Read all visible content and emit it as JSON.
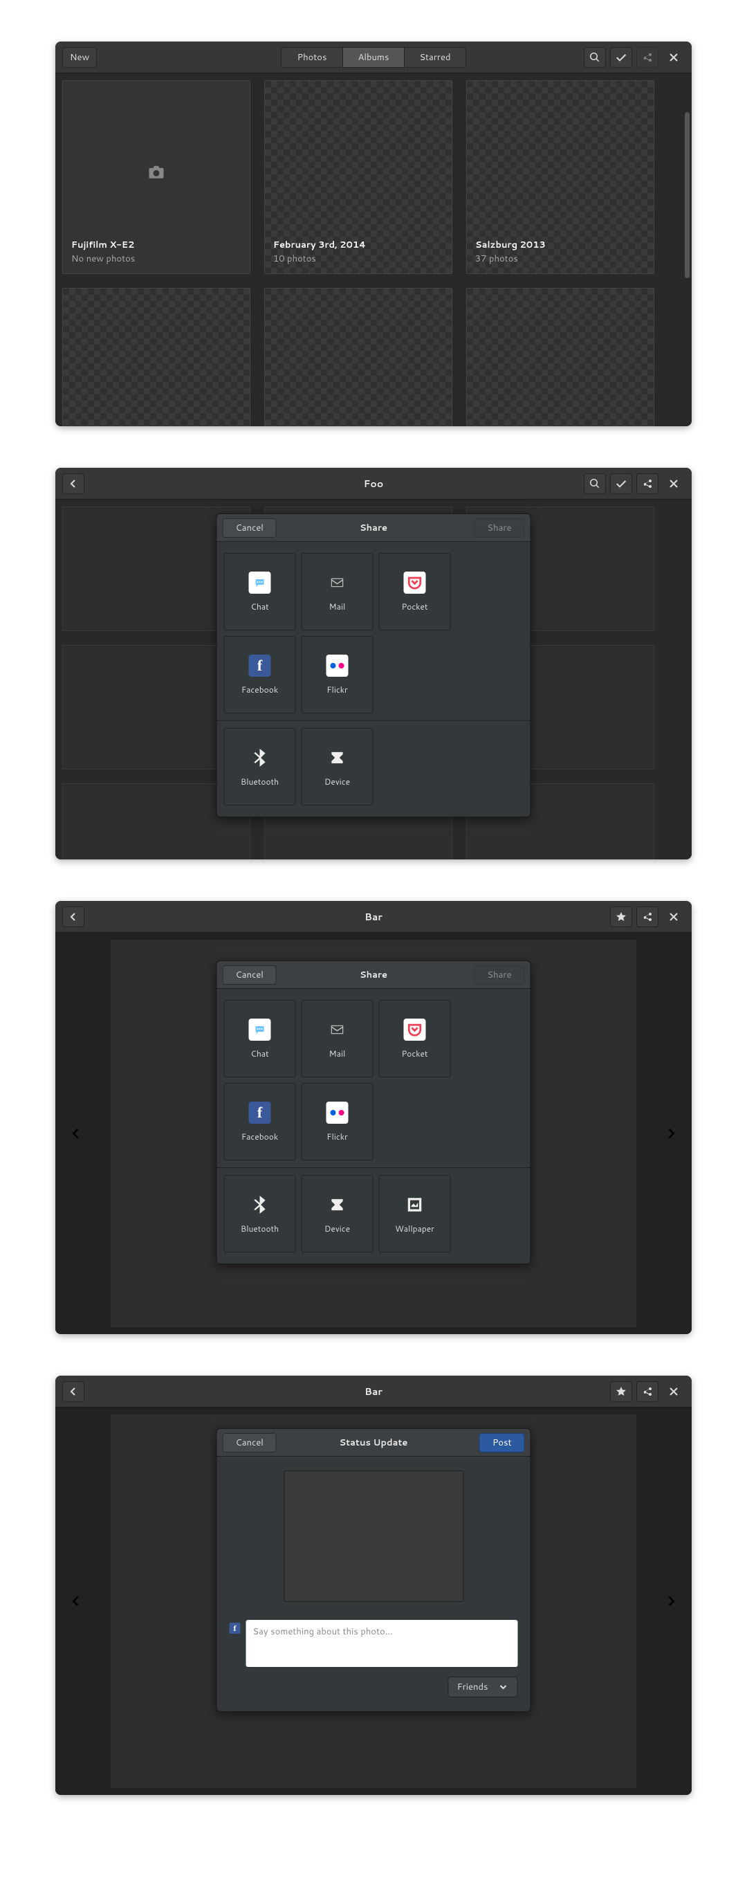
{
  "window1": {
    "newBtn": "New",
    "tabs": {
      "photos": "Photos",
      "albums": "Albums",
      "starred": "Starred"
    },
    "albums": [
      {
        "title": "Fujifilm X-E2",
        "sub": "No new photos"
      },
      {
        "title": "February 3rd, 2014",
        "sub": "10 photos"
      },
      {
        "title": "Salzburg 2013",
        "sub": "37 photos"
      }
    ]
  },
  "window2": {
    "title": "Foo",
    "dialog": {
      "cancel": "Cancel",
      "title": "Share",
      "action": "Share",
      "tiles": {
        "chat": "Chat",
        "mail": "Mail",
        "pocket": "Pocket",
        "facebook": "Facebook",
        "flickr": "Flickr",
        "bluetooth": "Bluetooth",
        "device": "Device"
      }
    }
  },
  "window3": {
    "title": "Bar",
    "dialog": {
      "cancel": "Cancel",
      "title": "Share",
      "action": "Share",
      "tiles": {
        "chat": "Chat",
        "mail": "Mail",
        "pocket": "Pocket",
        "facebook": "Facebook",
        "flickr": "Flickr",
        "bluetooth": "Bluetooth",
        "device": "Device",
        "wallpaper": "Wallpaper"
      }
    }
  },
  "window4": {
    "title": "Bar",
    "dialog": {
      "cancel": "Cancel",
      "title": "Status Update",
      "action": "Post",
      "placeholder": "Say something about this photo…",
      "privacy": "Friends"
    }
  }
}
